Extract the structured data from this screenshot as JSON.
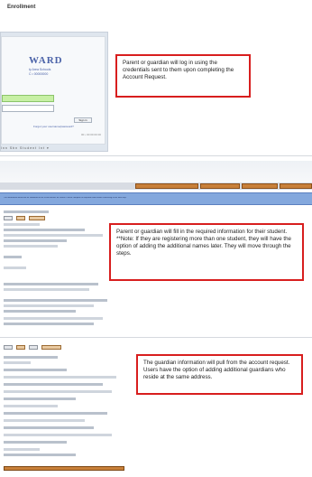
{
  "page": {
    "title": "Enrollment"
  },
  "login_screen": {
    "brand": "WARD",
    "brand_line_1": "ty Area Schools",
    "brand_line_2": "C • 00000000",
    "sign_in_label": "Sign in",
    "forgot_link": "Forgot your username/password?",
    "small_note": "00 • 00 00 00 00",
    "student_selector": "Inn Sbn Student Int ▾"
  },
  "form_screen": {
    "banner_text": "The information below will be submitted to the school district for review. Please complete all required fields before continuing to the next step."
  },
  "callouts": {
    "login": "Parent or guardian will log in using the credentials sent to them upon completing the Account Request.",
    "student_info": "Parent or guardian will fill in the required information for their student.  **Note: If they are registering more than one student, they will have the option of adding the additional names later.  They will move through the steps.",
    "guardian_info": "The guardian information will pull from the account request.  Users have the option of adding additional guardians who reside at the same address."
  },
  "colors": {
    "callout_border": "#d81e1e",
    "banner": "#84a8dd",
    "nav_tab": "#c8803a",
    "login_field": "#c7f0a4"
  }
}
